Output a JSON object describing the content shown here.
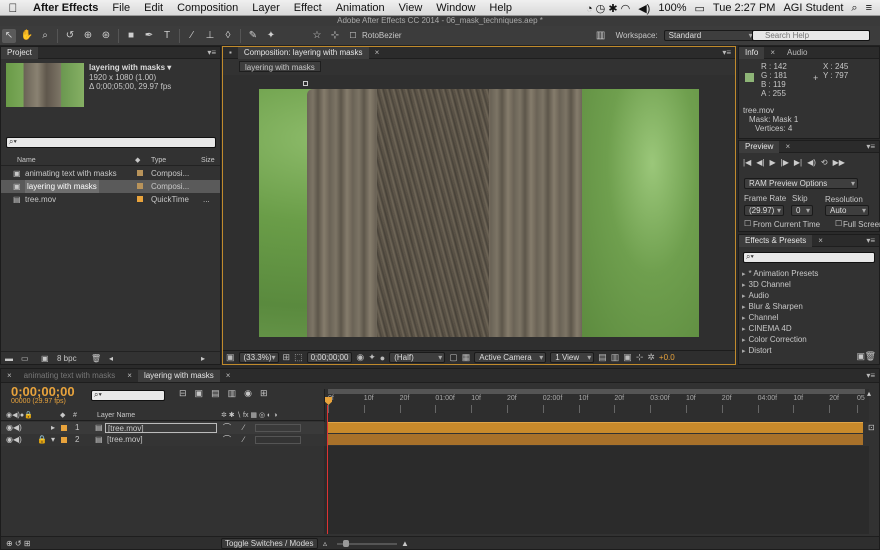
{
  "menubar": {
    "app_name": "After Effects",
    "items": [
      "File",
      "Edit",
      "Composition",
      "Layer",
      "Effect",
      "Animation",
      "View",
      "Window",
      "Help"
    ],
    "battery": "100%",
    "clock": "Tue 2:27 PM",
    "user": "AGI Student"
  },
  "window_title": "Adobe After Effects CC 2014 - 06_mask_techniques.aep *",
  "toolbar": {
    "rotobezier_label": "RotoBezier",
    "workspace_label": "Workspace:",
    "workspace_value": "Standard",
    "search_help_placeholder": "Search Help"
  },
  "project": {
    "tab": "Project",
    "item_name": "layering with masks ▾",
    "item_res": "1920 x 1080 (1.00)",
    "item_duration": "Δ 0;00;05;00, 29.97 fps",
    "columns": {
      "name": "Name",
      "type": "Type",
      "size": "Size"
    },
    "items": [
      {
        "name": "animating text with masks",
        "type": "Composi...",
        "size": "",
        "color": "#b8935a"
      },
      {
        "name": "layering with masks",
        "type": "Composi...",
        "size": "",
        "color": "#b8935a"
      },
      {
        "name": "tree.mov",
        "type": "QuickTime",
        "size": "...",
        "color": "#e8a33c"
      }
    ],
    "bpc": "8 bpc"
  },
  "composition": {
    "tab": "Composition: layering with masks",
    "subtab": "layering with masks",
    "zoom": "(33.3%)",
    "timecode": "0;00;00;00",
    "resolution": "(Half)",
    "camera": "Active Camera",
    "views": "1 View",
    "exposure": "+0.0"
  },
  "info": {
    "tab": "Info",
    "tab2": "Audio",
    "r": "R : 142",
    "g": "G : 181",
    "b": "B : 119",
    "a": "A : 255",
    "x": "X : 245",
    "y": "Y : 797",
    "layer": "tree.mov",
    "mask": "Mask: Mask 1",
    "vertices": "Vertices: 4",
    "swatch_color": "#8eb577"
  },
  "preview": {
    "tab": "Preview",
    "ram_options": "RAM Preview Options",
    "frame_rate_label": "Frame Rate",
    "skip_label": "Skip",
    "resolution_label": "Resolution",
    "frame_rate": "(29.97)",
    "skip": "0",
    "resolution": "Auto",
    "from_current": "From Current Time",
    "full_screen": "Full Screen"
  },
  "effects": {
    "tab": "Effects & Presets",
    "items": [
      "* Animation Presets",
      "3D Channel",
      "Audio",
      "Blur & Sharpen",
      "Channel",
      "CINEMA 4D",
      "Color Correction",
      "Distort"
    ]
  },
  "timeline": {
    "tabs": [
      "animating text with masks",
      "layering with masks"
    ],
    "timecode": "0;00;00;00",
    "fps": "00000 (29.97 fps)",
    "layer_name_header": "Layer Name",
    "ruler": [
      "0f",
      "10f",
      "20f",
      "01:00f",
      "10f",
      "20f",
      "02:00f",
      "10f",
      "20f",
      "03:00f",
      "10f",
      "20f",
      "04:00f",
      "10f",
      "20f",
      "05"
    ],
    "layers": [
      {
        "num": "1",
        "name": "[tree.mov]"
      },
      {
        "num": "2",
        "name": "[tree.mov]"
      }
    ],
    "toggle_label": "Toggle Switches / Modes"
  }
}
